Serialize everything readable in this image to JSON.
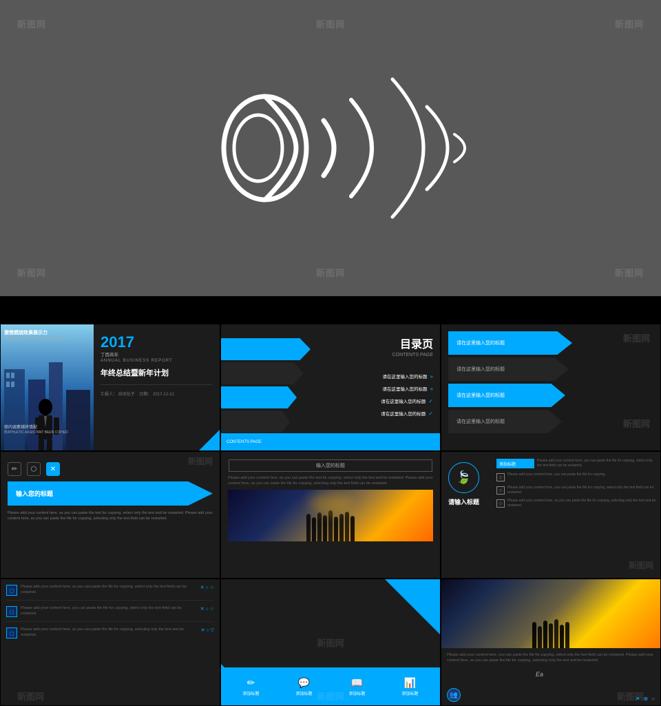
{
  "watermarks": {
    "label": "新图网",
    "positions": [
      "top-left",
      "top-center",
      "top-right",
      "bottom-left",
      "bottom-center",
      "bottom-right"
    ]
  },
  "top_section": {
    "background_color": "#555555",
    "speaker_icon": "sound-wave-speaker"
  },
  "black_band": {
    "height": 40
  },
  "slides": [
    {
      "id": "slide-1",
      "type": "cover",
      "year": "2017",
      "year_sub": "丁酉商年",
      "report_type": "ANNUAL BUSINESS REPORT",
      "title_zh": "年终总结暨新年计划",
      "author_label": "汇报人：",
      "author_value": "自动化子",
      "date_label": "日期：",
      "date_value": "2017-12-12",
      "tagline1": "激情燃烧效果展示力",
      "tagline2": "TO ADMINISTRATIVE CONFIRMATION",
      "tagline3": "所衣茬素辅将错配"
    },
    {
      "id": "slide-2",
      "type": "contents",
      "title": "目录页",
      "subtitle": "CONTENTS PAGE",
      "items": [
        "请在这里输入您的标题",
        "请在这里输入您的标题",
        "请在这里输入您的标题",
        "请在这里输入您的标题"
      ]
    },
    {
      "id": "slide-3",
      "type": "icon-row",
      "icons": [
        "pencil",
        "link",
        "cross"
      ],
      "title": "输入您的标题"
    },
    {
      "id": "slide-4",
      "type": "input-section",
      "title_placeholder": "输入您的标题",
      "body_text": "Please add your content here, as you can paste the text for copying, select only the text and be restarted. Please add your content here, as you can paste the file for copying, selecting only the text field can be restarted."
    },
    {
      "id": "slide-5",
      "type": "feature-icon",
      "icon": "leaf",
      "feature_title": "请输入标题",
      "feature_items": [
        "添加标题",
        "添加标题",
        "添加标题",
        "添加标题"
      ],
      "feature_texts": [
        "Please add your content here, you can paste the file for copying, select only the text field can be restarted.",
        "Please add your content here, you can paste the file for copying.",
        "Please add your content here, you can paste the file for copying, select only the text field can be restarted.",
        "Please add your content here, as you can paste the file for copying, selecting only the text and be restarted."
      ]
    },
    {
      "id": "slide-6",
      "type": "list-items",
      "items": [
        {
          "icon": "box",
          "text": "Please add your content here, as you can paste the file for copying, select only the text field can be restarted.",
          "controls": "X ○ ☆"
        },
        {
          "icon": "box",
          "text": "Please add your content here, you can paste the file for copying, select only the text field can be restarted.",
          "controls": "X ○ ☆"
        },
        {
          "icon": "box",
          "text": "Please add your content here, as you can paste the file for copying, selecting only the text and be restarted.",
          "controls": "X ○ ▽"
        }
      ]
    },
    {
      "id": "slide-7",
      "type": "toolbar",
      "items": [
        {
          "icon": "pencil",
          "label": "添加标题"
        },
        {
          "icon": "chat",
          "label": "添加标题"
        },
        {
          "icon": "book",
          "label": "添加标题"
        },
        {
          "icon": "chart",
          "label": "添加标题"
        }
      ]
    },
    {
      "id": "slide-8",
      "type": "photo-text",
      "body_text": "Please add your content here, you can paste the file for copying, select only the text field can be restarted. Please add your content here, as you can paste the file for copying, selecting only the text and be restarted.",
      "controls": "X ⊕ ○"
    },
    {
      "id": "slide-9",
      "type": "feature-list-right",
      "items": [
        {
          "label": "添加标题",
          "text": "Please add your content here, you can paste the file for copying, select only the text field can be restarted."
        },
        {
          "label": "添加标题",
          "text": "Please add your content here, you can paste."
        },
        {
          "label": "添加标题",
          "text": "Please add your content here, you can paste the file for copying, select only the text."
        },
        {
          "label": "添加标题",
          "text": "Please add your content here, as you can paste, selecting only."
        }
      ]
    }
  ],
  "detected_text": {
    "ea_label": "Ea"
  }
}
